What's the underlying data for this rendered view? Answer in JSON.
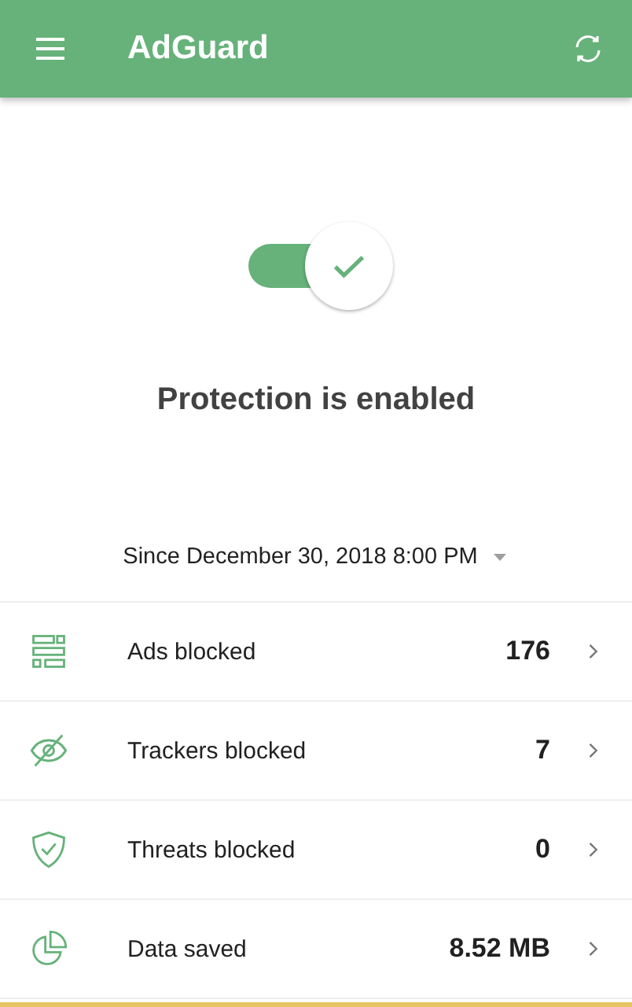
{
  "app_bar": {
    "title": "AdGuard"
  },
  "protection": {
    "on": true,
    "status": "Protection is enabled"
  },
  "period": {
    "label": "Since December 30, 2018 8:00 PM"
  },
  "stats": [
    {
      "kind": "ads",
      "label": "Ads blocked",
      "value": "176"
    },
    {
      "kind": "trackers",
      "label": "Trackers blocked",
      "value": "7"
    },
    {
      "kind": "threats",
      "label": "Threats blocked",
      "value": "0"
    },
    {
      "kind": "data",
      "label": "Data saved",
      "value": "8.52 MB"
    }
  ]
}
